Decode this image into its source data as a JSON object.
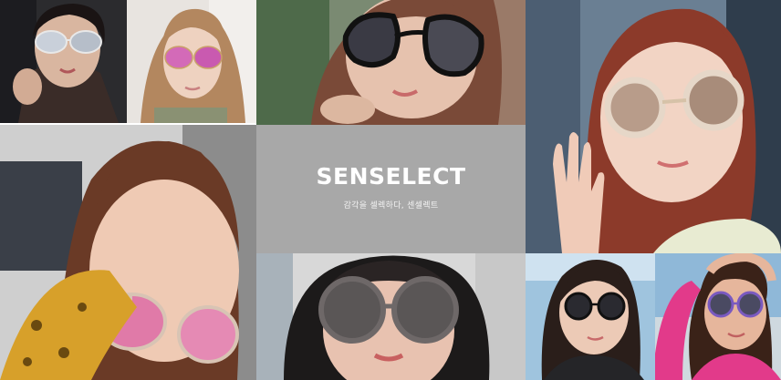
{
  "brand": {
    "name": "SENSELECT",
    "tagline": "감각을 셀렉하다, 센셀렉트"
  },
  "colors": {
    "center_panel": "#a8a8a8",
    "text": "#ffffff"
  },
  "photos": [
    {
      "name": "photo-woman-mirrored-sunglasses"
    },
    {
      "name": "photo-woman-pink-lens-sunglasses"
    },
    {
      "name": "photo-woman-black-cateye-sunglasses"
    },
    {
      "name": "photo-woman-gold-round-sunglasses-waving"
    },
    {
      "name": "photo-woman-pink-mirror-sunglasses-yellow-dress"
    },
    {
      "name": "photo-woman-hood-grey-round-sunglasses"
    },
    {
      "name": "photo-woman-black-round-sunglasses"
    },
    {
      "name": "photo-woman-beach-purple-sunglasses"
    }
  ]
}
